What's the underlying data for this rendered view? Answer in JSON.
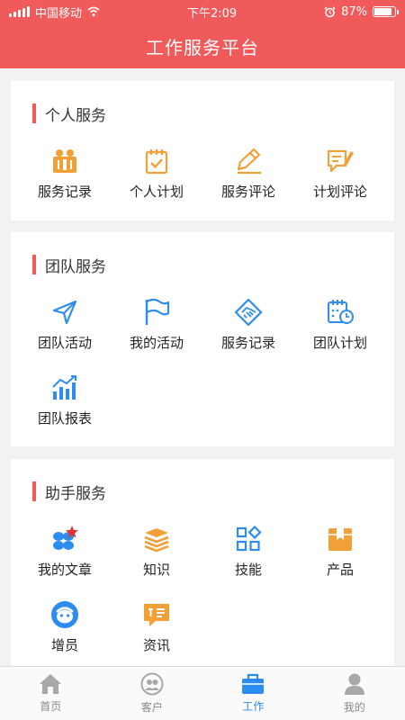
{
  "status": {
    "carrier": "中国移动",
    "time": "下午2:09",
    "battery": "87%",
    "battery_level": 0.87
  },
  "header": {
    "title": "工作服务平台"
  },
  "sections": {
    "personal": {
      "title": "个人服务",
      "items": [
        {
          "label": "服务记录",
          "icon": "service-record-icon"
        },
        {
          "label": "个人计划",
          "icon": "personal-plan-icon"
        },
        {
          "label": "服务评论",
          "icon": "service-review-icon"
        },
        {
          "label": "计划评论",
          "icon": "plan-review-icon"
        }
      ]
    },
    "team": {
      "title": "团队服务",
      "items": [
        {
          "label": "团队活动",
          "icon": "navigation-arrow-icon"
        },
        {
          "label": "我的活动",
          "icon": "flag-icon"
        },
        {
          "label": "服务记录",
          "icon": "handshake-icon"
        },
        {
          "label": "团队计划",
          "icon": "calendar-clock-icon"
        },
        {
          "label": "团队报表",
          "icon": "bar-chart-icon"
        }
      ]
    },
    "assistant": {
      "title": "助手服务",
      "items": [
        {
          "label": "我的文章",
          "icon": "article-icon"
        },
        {
          "label": "知识",
          "icon": "books-icon"
        },
        {
          "label": "技能",
          "icon": "skills-grid-icon"
        },
        {
          "label": "产品",
          "icon": "product-box-icon"
        },
        {
          "label": "增员",
          "icon": "recruit-face-icon"
        },
        {
          "label": "资讯",
          "icon": "news-chat-icon"
        }
      ]
    }
  },
  "tabbar": {
    "items": [
      {
        "label": "首页",
        "icon": "home-icon"
      },
      {
        "label": "客户",
        "icon": "customers-icon"
      },
      {
        "label": "工作",
        "icon": "briefcase-icon"
      },
      {
        "label": "我的",
        "icon": "profile-icon"
      }
    ],
    "active_index": 2
  },
  "colors": {
    "brand": "#f15a5a",
    "orange": "#f0a036",
    "blue": "#2d8cf0",
    "tab_inactive": "#888888"
  }
}
